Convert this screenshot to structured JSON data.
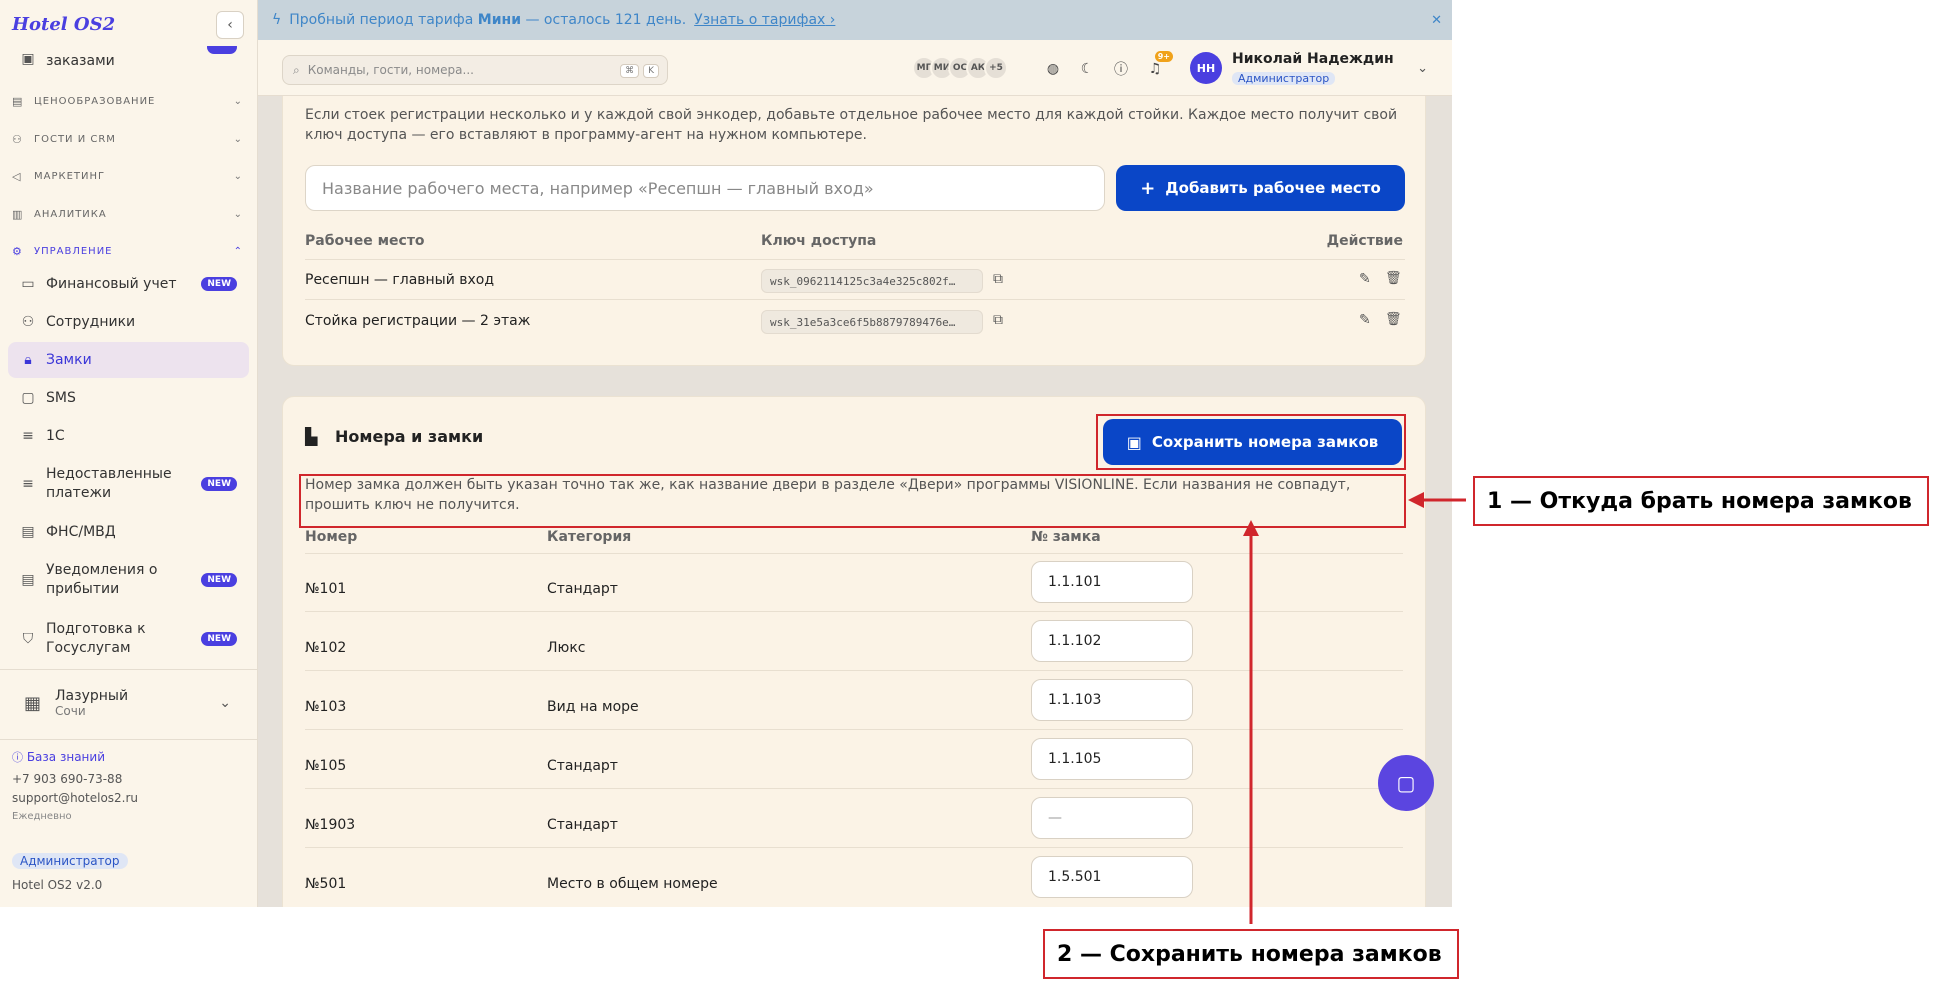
{
  "sidebar": {
    "brand": "Hotel OS2",
    "collapse_icon": "‹",
    "top_partial_label": "заказами",
    "sections": [
      {
        "label": "ЦЕНООБРАЗОВАНИЕ",
        "icon": "pricing-icon"
      },
      {
        "label": "ГОСТИ И CRM",
        "icon": "guests-icon"
      },
      {
        "label": "МАРКЕТИНГ",
        "icon": "marketing-icon"
      },
      {
        "label": "АНАЛИТИКА",
        "icon": "analytics-icon"
      },
      {
        "label": "УПРАВЛЕНИЕ",
        "icon": "gear-icon"
      }
    ],
    "items": [
      {
        "label": "Финансовый учет",
        "badge": "NEW"
      },
      {
        "label": "Сотрудники",
        "badge": ""
      },
      {
        "label": "Замки",
        "badge": ""
      },
      {
        "label": "SMS",
        "badge": ""
      },
      {
        "label": "1С",
        "badge": ""
      },
      {
        "label": "Недоставленные платежи",
        "badge": "NEW"
      },
      {
        "label": "ФНС/МВД",
        "badge": ""
      },
      {
        "label": "Уведомления о прибытии",
        "badge": "NEW"
      },
      {
        "label": "Подготовка к Госуслугам",
        "badge": "NEW"
      }
    ],
    "hotel": {
      "name": "Лазурный",
      "city": "Сочи"
    },
    "footer": {
      "kb_link": "База знаний",
      "phone": "+7 903 690-73-88",
      "email": "support@hotelos2.ru",
      "hours": "Ежедневно",
      "role_badge": "Администратор",
      "version": "Hotel OS2 v2.0"
    }
  },
  "banner": {
    "text_before": "Пробный период тарифа",
    "plan": "Мини",
    "text_after": "— осталось 121 день.",
    "link": "Узнать о тарифах",
    "close": "✕"
  },
  "topbar": {
    "search_placeholder": "Команды, гости, номера...",
    "kbd1": "⌘",
    "kbd2": "K",
    "avatars": [
      "МГ",
      "МИ",
      "ОС",
      "АК"
    ],
    "more_count": "+5",
    "notif_count": "9+",
    "user": {
      "initials": "НН",
      "name": "Николай Надеждин",
      "role": "Администратор"
    }
  },
  "workstations": {
    "description": "Если стоек регистрации несколько и у каждой свой энкодер, добавьте отдельное рабочее место для каждой стойки. Каждое место получит свой ключ доступа — его вставляют в программу-агент на нужном компьютере.",
    "input_placeholder": "Название рабочего места, например «Ресепшн — главный вход»",
    "add_button": "Добавить рабочее место",
    "headers": {
      "name": "Рабочее место",
      "key": "Ключ доступа",
      "action": "Действие"
    },
    "rows": [
      {
        "name": "Ресепшн — главный вход",
        "key": "wsk_0962114125c3a4e325c802f…"
      },
      {
        "name": "Стойка регистрации — 2 этаж",
        "key": "wsk_31e5a3ce6f5b8879789476e…"
      }
    ]
  },
  "rooms": {
    "title": "Номера и замки",
    "save_button": "Сохранить номера замков",
    "hint": "Номер замка должен быть указан точно так же, как название двери в разделе «Двери» программы VISIONLINE. Если названия не совпадут, прошить ключ не получится.",
    "headers": {
      "room": "Номер",
      "category": "Категория",
      "lock": "№ замка"
    },
    "rows": [
      {
        "room": "№101",
        "category": "Стандарт",
        "lock": "1.1.101"
      },
      {
        "room": "№102",
        "category": "Люкс",
        "lock": "1.1.102"
      },
      {
        "room": "№103",
        "category": "Вид на море",
        "lock": "1.1.103"
      },
      {
        "room": "№105",
        "category": "Стандарт",
        "lock": "1.1.105"
      },
      {
        "room": "№1903",
        "category": "Стандарт",
        "lock": "—"
      },
      {
        "room": "№501",
        "category": "Место в общем номере",
        "lock": "1.5.501"
      }
    ]
  },
  "annotations": {
    "label1": "1 — Откуда брать номера замков",
    "label2": "2 — Сохранить номера замков"
  },
  "colors": {
    "accent": "#0a46c7",
    "brand": "#4a3fe0",
    "annotation": "#d0262c"
  }
}
